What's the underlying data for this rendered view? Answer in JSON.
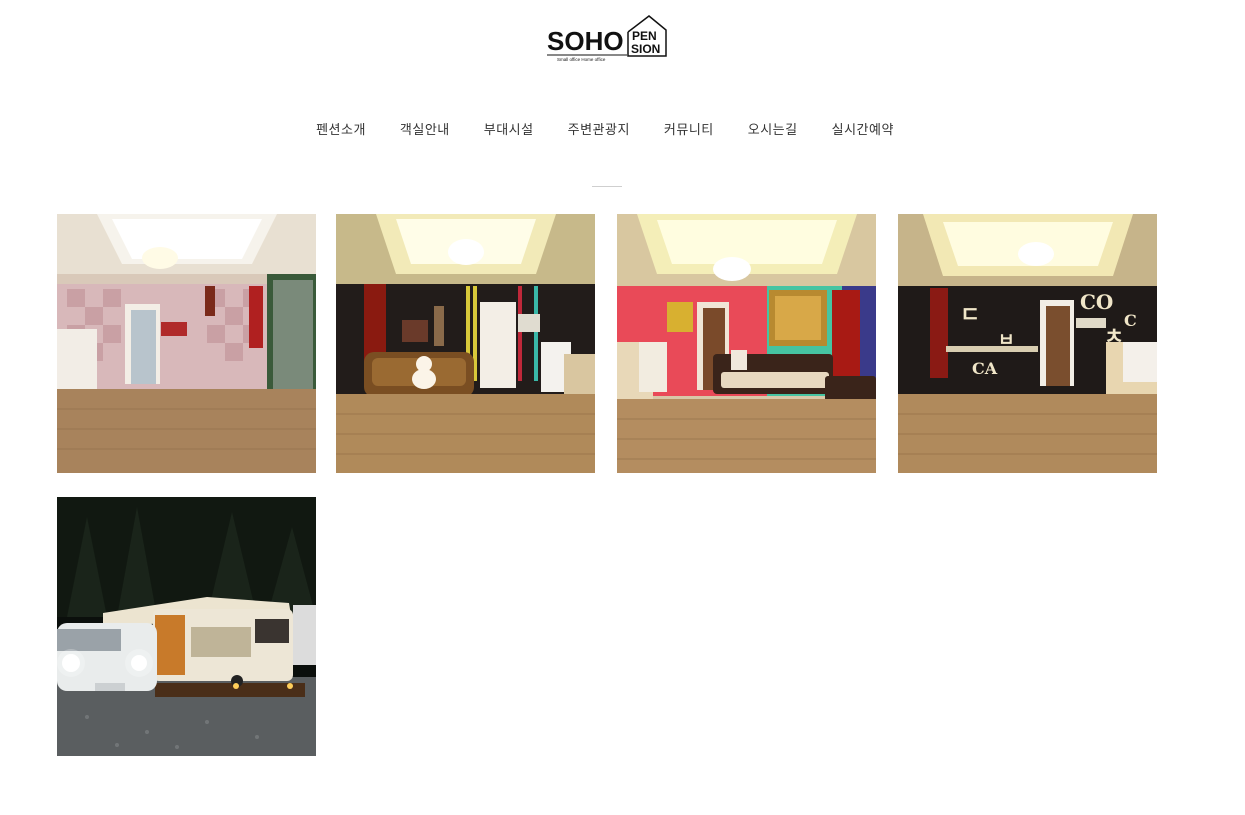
{
  "logo": {
    "main": "SOHO",
    "house_top": "PEN",
    "house_bottom": "SION",
    "tagline": "Small office Home office"
  },
  "nav": {
    "items": [
      {
        "label": "펜션소개"
      },
      {
        "label": "객실안내"
      },
      {
        "label": "부대시설"
      },
      {
        "label": "주변관광지"
      },
      {
        "label": "커뮤니티"
      },
      {
        "label": "오시는길"
      },
      {
        "label": "실시간예약"
      }
    ]
  },
  "gallery": {
    "items": [
      {
        "icon": "room-photo-pink-tile"
      },
      {
        "icon": "room-photo-teddy-bear-sofa"
      },
      {
        "icon": "room-photo-colorful-walls"
      },
      {
        "icon": "room-photo-letter-decor"
      },
      {
        "icon": "caravan-night-photo"
      }
    ]
  }
}
